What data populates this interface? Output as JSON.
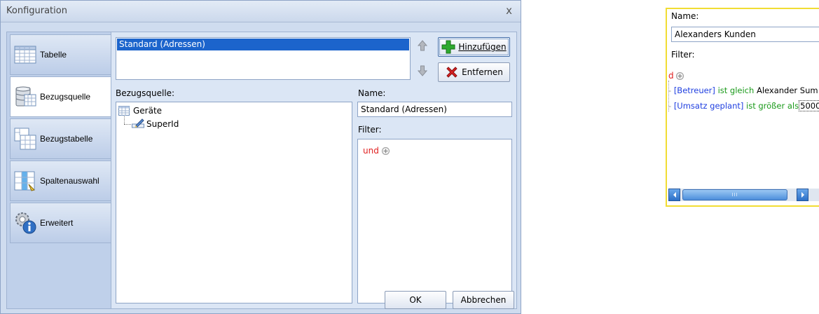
{
  "dialog": {
    "title": "Konfiguration",
    "close": "x"
  },
  "nav": [
    {
      "label": "Tabelle",
      "icon": "table-icon",
      "active": false
    },
    {
      "label": "Bezugsquelle",
      "icon": "database-icon",
      "active": true
    },
    {
      "label": "Bezugstabelle",
      "icon": "related-table-icon",
      "active": false
    },
    {
      "label": "Spaltenauswahl",
      "icon": "column-selection-icon",
      "active": false
    },
    {
      "label": "Erweitert",
      "icon": "gear-info-icon",
      "active": false
    }
  ],
  "views": {
    "items": [
      "Standard (Adressen)"
    ],
    "selected": 0,
    "add_label": "Hinzufügen",
    "remove_label": "Entfernen"
  },
  "source": {
    "label": "Bezugsquelle:",
    "tree": {
      "root": "Geräte",
      "child": "SuperId"
    }
  },
  "right": {
    "name_label": "Name:",
    "name_value": "Standard (Adressen)",
    "filter_label": "Filter:",
    "filter_op": "und"
  },
  "footer": {
    "ok_label": "OK",
    "cancel_label": "Abbrechen"
  },
  "crop": {
    "name_label": "Name:",
    "name_value": "Alexanders Kunden",
    "filter_label": "Filter:",
    "op_partial": "d",
    "rows": [
      {
        "field": "[Betreuer]",
        "operator": "ist gleich",
        "value": "Alexander Sum"
      },
      {
        "field": "[Umsatz geplant]",
        "operator": "ist größer als",
        "value": "5000"
      }
    ],
    "scroll_grip": "III"
  },
  "colors": {
    "selection": "#1c64cc",
    "dialog_bg": "#cfdcef",
    "crop_border": "#f1dd33"
  }
}
